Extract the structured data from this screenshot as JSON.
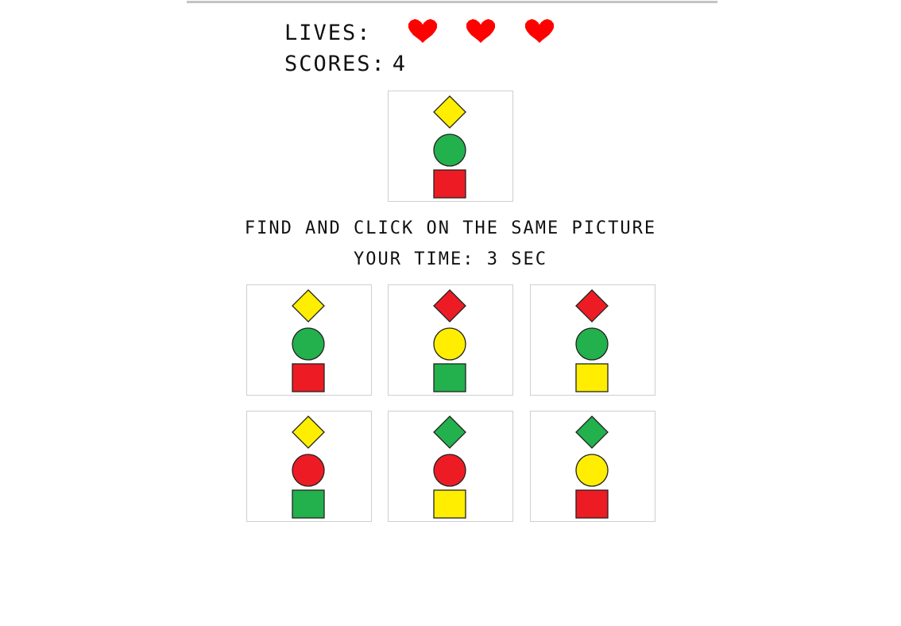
{
  "hud": {
    "lives_label": "LIVES:",
    "lives": 3,
    "scores_label": "SCORES:",
    "score": "4"
  },
  "colors": {
    "yellow": "#ffee00",
    "green": "#22b14c",
    "red": "#ed1c24",
    "heart": "#ff0000"
  },
  "target": {
    "diamond": "yellow",
    "circle": "green",
    "square": "red"
  },
  "instruction": "FIND AND CLICK ON THE SAME PICTURE",
  "timer": {
    "text": "YOUR TIME: 3 SEC"
  },
  "options": [
    {
      "diamond": "yellow",
      "circle": "green",
      "square": "red"
    },
    {
      "diamond": "red",
      "circle": "yellow",
      "square": "green"
    },
    {
      "diamond": "red",
      "circle": "green",
      "square": "yellow"
    },
    {
      "diamond": "yellow",
      "circle": "red",
      "square": "green"
    },
    {
      "diamond": "green",
      "circle": "red",
      "square": "yellow"
    },
    {
      "diamond": "green",
      "circle": "yellow",
      "square": "red"
    }
  ]
}
